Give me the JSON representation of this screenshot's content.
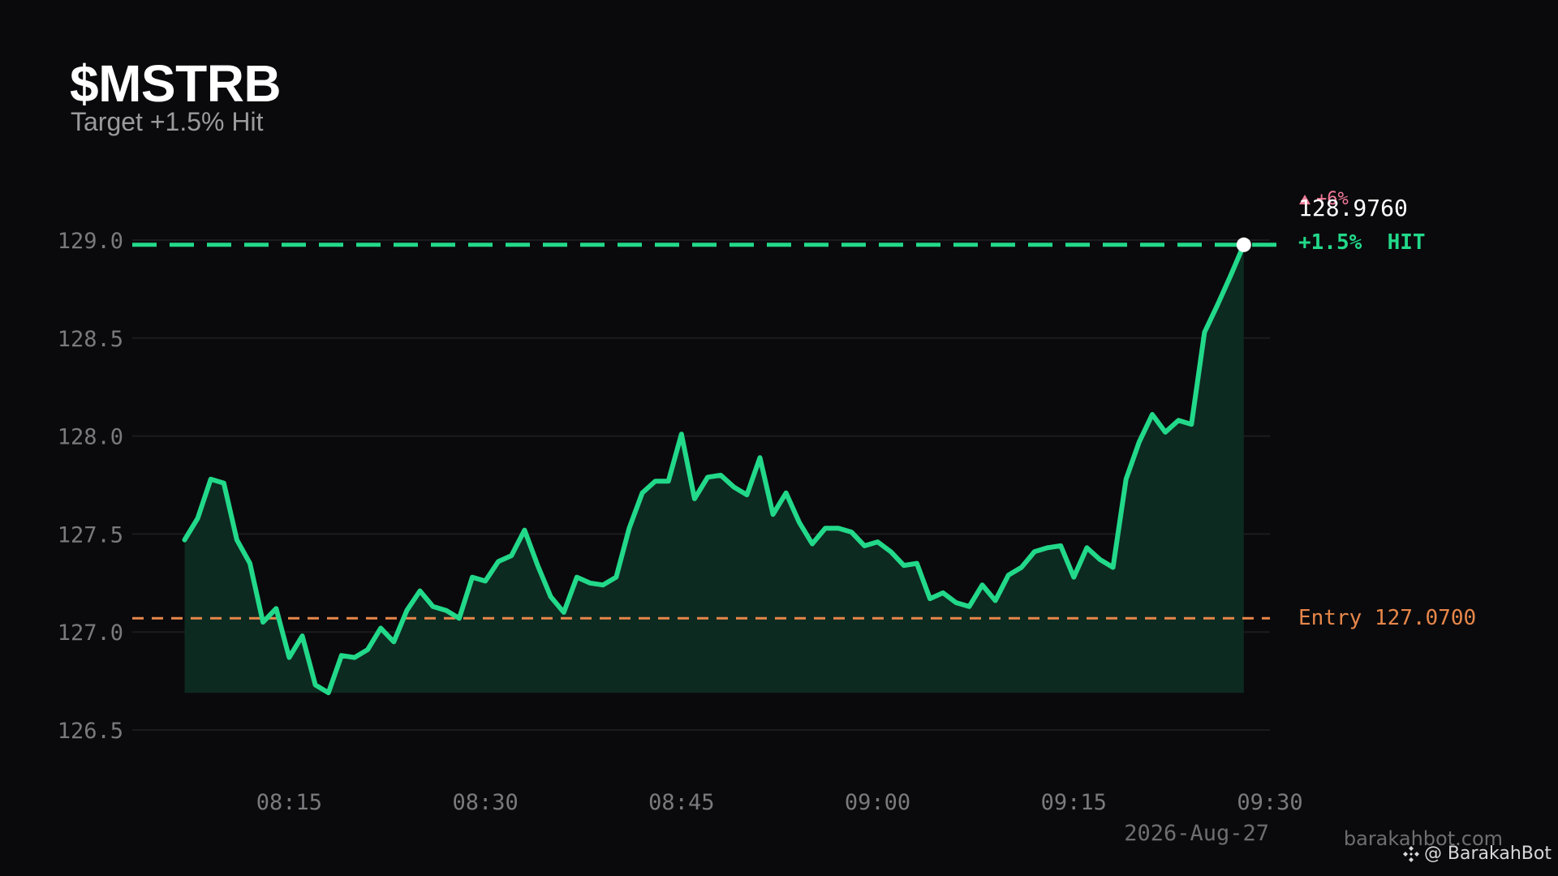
{
  "header": {
    "ticker": "$MSTRB",
    "subtitle": "Target +1.5% Hit"
  },
  "annotations": {
    "last_price": "128.9760",
    "change_badge": "+6%",
    "target_label": "+1.5%  HIT",
    "entry_label": "Entry 127.0700",
    "date_label": "2026-Aug-27"
  },
  "branding": {
    "site": "barakahbot.com",
    "handle": "@ BarakahBot",
    "icon": "binance-icon"
  },
  "colors": {
    "background": "#0a0a0c",
    "line": "#22d98a",
    "fill": "#0d2a20",
    "target": "#22d98a",
    "entry": "#e8874a",
    "badge": "#f07a9a",
    "grid": "#1c1c20",
    "tick": "#7a7a7e"
  },
  "chart_data": {
    "type": "area",
    "x_unit": "minutes since 08:00",
    "xlim": [
      "08:03",
      "09:30"
    ],
    "ylim": [
      126.3,
      129.2
    ],
    "yticks": [
      "126.5",
      "127.0",
      "127.5",
      "128.0",
      "128.5",
      "129.0"
    ],
    "ytick_values": [
      126.5,
      127.0,
      127.5,
      128.0,
      128.5,
      129.0
    ],
    "xticks": [
      "08:15",
      "08:30",
      "08:45",
      "09:00",
      "09:15",
      "09:30"
    ],
    "entry": 127.07,
    "target": 128.976,
    "grid": true,
    "series": [
      {
        "times": [
          "08:07",
          "08:08",
          "08:09",
          "08:10",
          "08:11",
          "08:12",
          "08:13",
          "08:14",
          "08:15",
          "08:16",
          "08:17",
          "08:18",
          "08:19",
          "08:20",
          "08:21",
          "08:22",
          "08:23",
          "08:24",
          "08:25",
          "08:26",
          "08:27",
          "08:28",
          "08:29",
          "08:30",
          "08:31",
          "08:32",
          "08:33",
          "08:34",
          "08:35",
          "08:36",
          "08:37",
          "08:38",
          "08:39",
          "08:40",
          "08:41",
          "08:42",
          "08:43",
          "08:44",
          "08:45",
          "08:46",
          "08:47",
          "08:48",
          "08:49",
          "08:50",
          "08:51",
          "08:52",
          "08:53",
          "08:54",
          "08:55",
          "08:56",
          "08:57",
          "08:58",
          "08:59",
          "09:00",
          "09:01",
          "09:02",
          "09:03",
          "09:04",
          "09:05",
          "09:06",
          "09:07",
          "09:08",
          "09:09",
          "09:10",
          "09:11",
          "09:12",
          "09:13",
          "09:14",
          "09:15",
          "09:16",
          "09:17",
          "09:18",
          "09:19",
          "09:20",
          "09:21",
          "09:22",
          "09:23",
          "09:24",
          "09:25",
          "09:26",
          "09:27",
          "09:28"
        ],
        "values": [
          127.47,
          127.58,
          127.78,
          127.76,
          127.47,
          127.35,
          127.05,
          127.12,
          126.87,
          126.98,
          126.73,
          126.69,
          126.88,
          126.87,
          126.91,
          127.02,
          126.95,
          127.11,
          127.21,
          127.13,
          127.11,
          127.07,
          127.28,
          127.26,
          127.36,
          127.39,
          127.52,
          127.34,
          127.18,
          127.1,
          127.28,
          127.25,
          127.24,
          127.28,
          127.53,
          127.71,
          127.77,
          127.77,
          128.01,
          127.68,
          127.79,
          127.8,
          127.74,
          127.7,
          127.89,
          127.6,
          127.71,
          127.56,
          127.45,
          127.53,
          127.53,
          127.51,
          127.44,
          127.46,
          127.41,
          127.34,
          127.35,
          127.17,
          127.2,
          127.15,
          127.13,
          127.24,
          127.16,
          127.29,
          127.33,
          127.41,
          127.43,
          127.44,
          127.28,
          127.43,
          127.37,
          127.33,
          127.78,
          127.97,
          128.11,
          128.02,
          128.08,
          128.06,
          128.53,
          128.67,
          128.82,
          128.976
        ]
      }
    ]
  }
}
